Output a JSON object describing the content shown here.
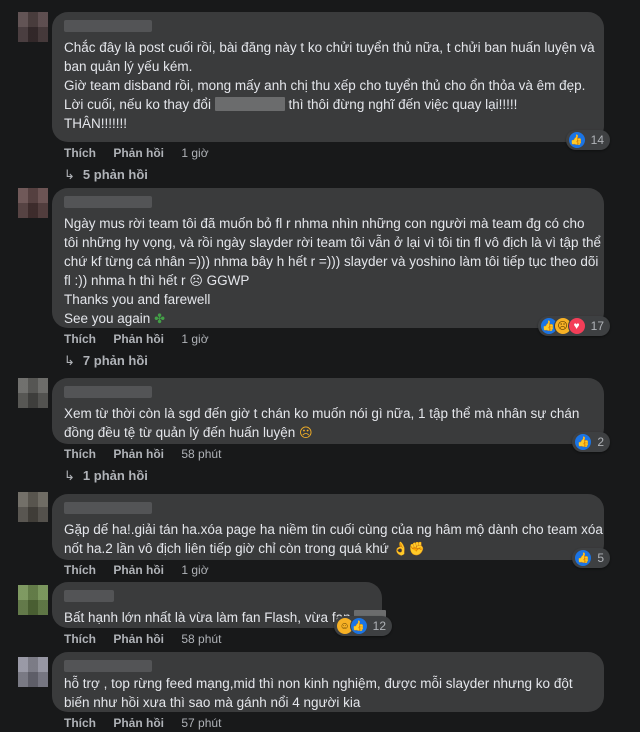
{
  "comments": [
    {
      "lines": [
        "Chắc đây là post cuối rồi, bài đăng này t ko chửi tuyển thủ nữa, t chửi ban huấn luyện và",
        "ban quản lý yếu kém.",
        "Giờ team disband rồi, mong mấy anh chị thu xếp cho tuyển thủ cho ổn thỏa và êm đẹp.",
        "Lời cuối, nếu ko thay đổi",
        "thì thôi đừng nghĩ đến việc quay lại!!!!!",
        "THÂN!!!!!!!"
      ],
      "reaction_count": "14",
      "like": "Thích",
      "reply": "Phản hồi",
      "time": "1 giờ",
      "replies": "5 phản hồi"
    },
    {
      "lines": [
        "Ngày mus rời team tôi đã muốn bỏ fl r nhma nhìn những con người mà team đg có cho",
        "tôi những hy vọng, và rồi ngày slayder rời team tôi vẫn ở lại vì tôi tin fl vô địch là vì tập thể",
        "chứ kf từng cá nhân =))) nhma bây h hết r =))) slayder và yoshino làm tôi tiếp tục theo dõi",
        "fl :)) nhma h thì hết r",
        "GGWP",
        "Thanks you and farewell",
        "See you again"
      ],
      "reaction_count": "17",
      "like": "Thích",
      "reply": "Phản hồi",
      "time": "1 giờ",
      "replies": "7 phản hồi"
    },
    {
      "lines": [
        "Xem từ thời còn là sgd đến giờ t chán ko muốn nói gì nữa, 1 tập thể mà nhân sự chán",
        "đồng đều tệ từ quản lý đến huấn luyện"
      ],
      "reaction_count": "2",
      "like": "Thích",
      "reply": "Phản hồi",
      "time": "58 phút",
      "replies": "1 phản hồi"
    },
    {
      "lines": [
        "Gặp dế ha!.giải tán ha.xóa page ha niềm tin cuối cùng của ng hâm mộ dành cho team xóa",
        "nốt ha.2 lần vô địch liên tiếp giờ chỉ còn trong quá khứ"
      ],
      "reaction_count": "5",
      "like": "Thích",
      "reply": "Phản hồi",
      "time": "1 giờ"
    },
    {
      "lines": [
        "Bất hạnh lớn nhất là vừa làm fan Flash, vừa fan"
      ],
      "reaction_count": "12",
      "like": "Thích",
      "reply": "Phản hồi",
      "time": "58 phút"
    },
    {
      "lines": [
        "hỗ trợ , top rừng feed mạng,mid thì non kinh nghiệm, được mỗi slayder nhưng ko đột",
        "biến như hồi xưa thì sao mà gánh nổi 4 người kia"
      ],
      "like": "Thích",
      "reply": "Phản hồi",
      "time": "57 phút"
    }
  ],
  "icons": {
    "like": "like-reaction-icon",
    "sad": "sad-reaction-icon",
    "love": "love-reaction-icon",
    "haha": "haha-reaction-icon",
    "reply_arrow": "reply-arrow-icon",
    "four_leaf_clover": "four-leaf-clover-emoji",
    "sad_face": "frowning-face-emoji",
    "ok_hand": "ok-hand-emoji",
    "fist": "fist-emoji",
    "disappointed": "disappointed-face-emoji"
  },
  "colors": {
    "background": "#18191a",
    "bubble": "#3a3b3c",
    "link": "#b0b3b8",
    "like_blue": "#1b74e4"
  }
}
